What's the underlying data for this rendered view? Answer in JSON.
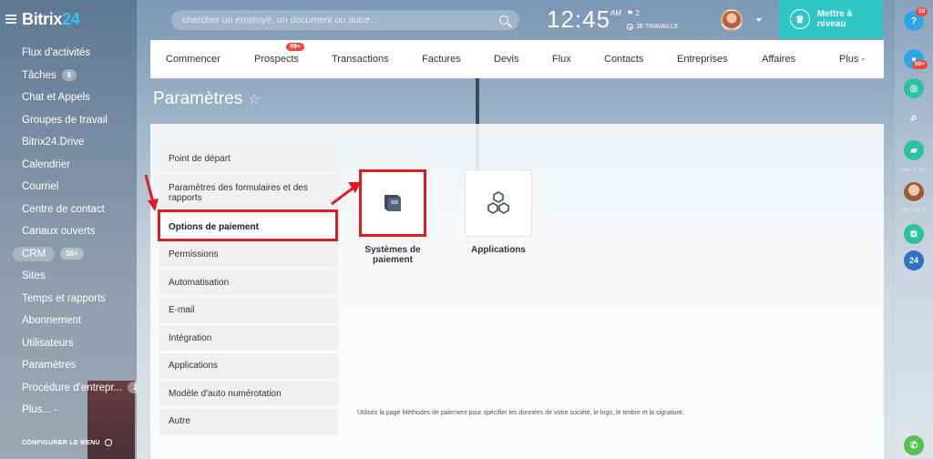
{
  "app": {
    "logo_text": "Bitrix",
    "logo_num": "24"
  },
  "search": {
    "placeholder": "chercher un employé, un document ou autre..."
  },
  "clock": {
    "time": "12:45",
    "ampm": "AM"
  },
  "status": {
    "flag_count": "2",
    "label": "JE TRAVAILLE"
  },
  "upgrade": {
    "label": "Mettre à niveau"
  },
  "sidebar": {
    "items": [
      {
        "label": "Flux d'activités"
      },
      {
        "label": "Tâches",
        "count": "6"
      },
      {
        "label": "Chat et Appels"
      },
      {
        "label": "Groupes de travail"
      },
      {
        "label": "Bitrix24.Drive"
      },
      {
        "label": "Calendrier"
      },
      {
        "label": "Courriel"
      },
      {
        "label": "Centre de contact"
      },
      {
        "label": "Canaux ouverts"
      },
      {
        "label": "CRM",
        "count": "50+"
      },
      {
        "label": "Sites"
      },
      {
        "label": "Temps et rapports"
      },
      {
        "label": "Abonnement"
      },
      {
        "label": "Utilisateurs"
      },
      {
        "label": "Paramètres"
      },
      {
        "label": "Procédure d'entrepr...",
        "count": "2"
      },
      {
        "label": "Plus... -"
      }
    ],
    "configure": "CONFIGURER LE MENU"
  },
  "tabs": {
    "items": [
      {
        "label": "Commencer"
      },
      {
        "label": "Prospects",
        "badge": "99+"
      },
      {
        "label": "Transactions"
      },
      {
        "label": "Factures"
      },
      {
        "label": "Devis"
      },
      {
        "label": "Flux"
      },
      {
        "label": "Contacts"
      },
      {
        "label": "Entreprises"
      },
      {
        "label": "Affaires"
      },
      {
        "label": "Plus -"
      }
    ]
  },
  "page": {
    "title": "Paramètres",
    "star": "☆"
  },
  "settings_menu": {
    "items": [
      {
        "label": "Point de départ"
      },
      {
        "label": "Paramètres des formulaires et des rapports"
      },
      {
        "label": "Options de paiement"
      },
      {
        "label": "Permissions"
      },
      {
        "label": "Automatisation"
      },
      {
        "label": "E-mail"
      },
      {
        "label": "Intégration"
      },
      {
        "label": "Applications"
      },
      {
        "label": "Modèle d'auto numérotation"
      },
      {
        "label": "Autre"
      }
    ]
  },
  "tiles": {
    "payment": "Systèmes de paiement",
    "apps": "Applications"
  },
  "footnote": "Utilisez la page Méthodes de paiement pour spécifier les données de votre société, le logo, le timbre et la signature.",
  "rail": {
    "help_badge": "10",
    "notif_badge": "50+",
    "date1": "Ven., 5 Oc...",
    "date2": "Dim., 23 S...",
    "b24": "24",
    "help": "?"
  },
  "colors": {
    "accent": "#2fc7c6",
    "highlight": "#e01b24",
    "badge": "#f0493a"
  }
}
